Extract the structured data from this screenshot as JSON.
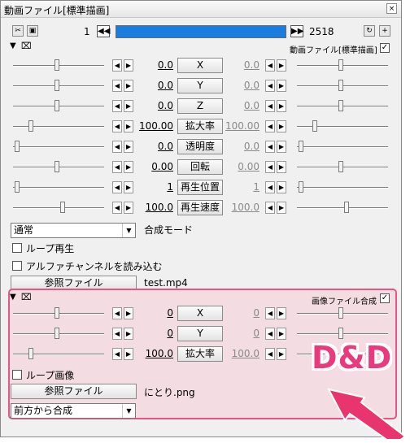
{
  "window": {
    "title": "動画ファイル[標準描画]",
    "close_glyph": "×"
  },
  "toolbar": {
    "start_frame": "1",
    "end_frame": "2518",
    "prev_glyph": "◀◀",
    "next_glyph": "▶▶",
    "progress": 0.0
  },
  "main_object": {
    "label": "動画ファイル[標準描画]",
    "checked": true,
    "params": [
      {
        "name": "X",
        "left": "0.0",
        "right": "0.0",
        "left_pos": 0.48,
        "right_pos": 0.48
      },
      {
        "name": "Y",
        "left": "0.0",
        "right": "0.0",
        "left_pos": 0.48,
        "right_pos": 0.48
      },
      {
        "name": "Z",
        "left": "0.0",
        "right": "0.0",
        "left_pos": 0.48,
        "right_pos": 0.48
      },
      {
        "name": "拡大率",
        "left": "100.00",
        "right": "100.00",
        "left_pos": 0.18,
        "right_pos": 0.18
      },
      {
        "name": "透明度",
        "left": "0.0",
        "right": "0.0",
        "left_pos": 0.02,
        "right_pos": 0.02
      },
      {
        "name": "回転",
        "left": "0.00",
        "right": "0.00",
        "left_pos": 0.48,
        "right_pos": 0.48
      },
      {
        "name": "再生位置",
        "left": "1",
        "right": "1",
        "left_pos": 0.02,
        "right_pos": 0.02
      },
      {
        "name": "再生速度",
        "left": "100.0",
        "right": "100.0",
        "left_pos": 0.55,
        "right_pos": 0.55
      }
    ],
    "blend_mode": "通常",
    "blend_label": "合成モード",
    "loop_label": "ループ再生",
    "alpha_label": "アルファチャンネルを読み込む",
    "ref_button": "参照ファイル",
    "filename": "test.mp4"
  },
  "filter_object": {
    "label": "画像ファイル合成",
    "checked": true,
    "params": [
      {
        "name": "X",
        "left": "0",
        "right": "0",
        "left_pos": 0.48,
        "right_pos": 0.48
      },
      {
        "name": "Y",
        "left": "0",
        "right": "0",
        "left_pos": 0.48,
        "right_pos": 0.48
      },
      {
        "name": "拡大率",
        "left": "100.0",
        "right": "100.0",
        "left_pos": 0.18,
        "right_pos": 0.18
      }
    ],
    "loop_label": "ループ画像",
    "ref_button": "参照ファイル",
    "filename": "にとり.png",
    "mode": "前方から合成"
  },
  "annotation": {
    "text": "D&D",
    "color": "#e93a7e"
  }
}
